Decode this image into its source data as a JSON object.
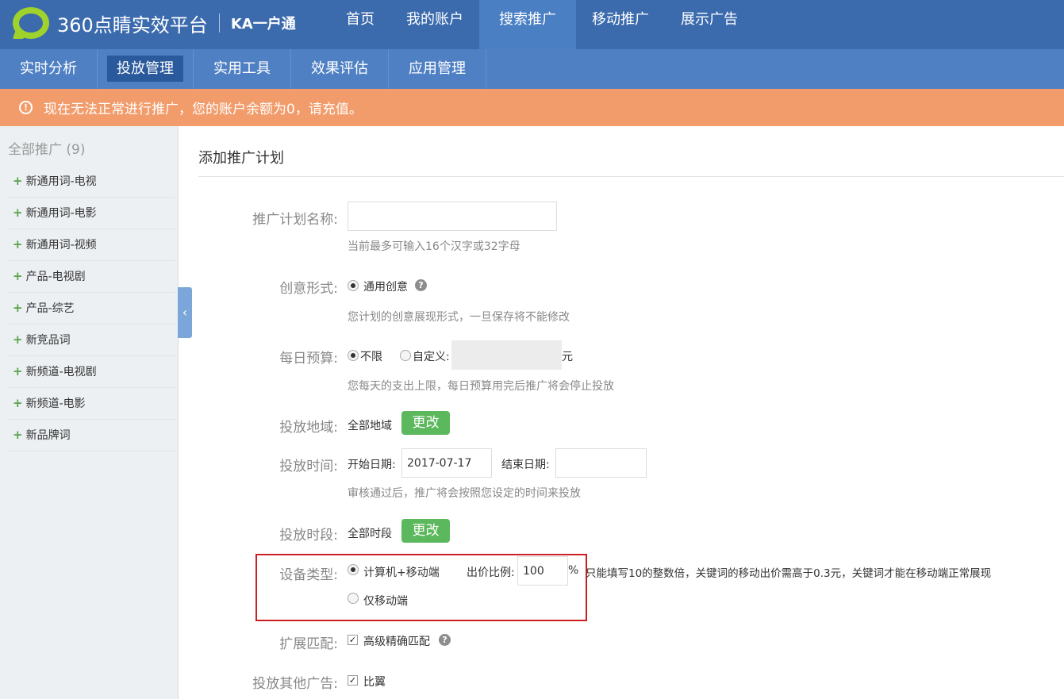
{
  "brand": {
    "name": "360点睛实效平台",
    "product": "KA一户通"
  },
  "topnav": [
    "首页",
    "我的账户",
    "搜索推广",
    "移动推广",
    "展示广告"
  ],
  "subnav": [
    "实时分析",
    "投放管理",
    "实用工具",
    "效果评估",
    "应用管理"
  ],
  "alert": {
    "text": "现在无法正常进行推广，您的账户余额为0，请充值。"
  },
  "sidebar": {
    "title": "全部推广 (9)",
    "items": [
      "新通用词-电视",
      "新通用词-电影",
      "新通用词-视频",
      "产品-电视剧",
      "产品-综艺",
      "新竞品词",
      "新频道-电视剧",
      "新频道-电影",
      "新品牌词"
    ]
  },
  "form": {
    "title": "添加推广计划",
    "plan_name": {
      "label": "推广计划名称:",
      "value": "",
      "hint": "当前最多可输入16个汉字或32字母"
    },
    "creative": {
      "label": "创意形式:",
      "option": "通用创意",
      "hint": "您计划的创意展现形式，一旦保存将不能修改"
    },
    "budget": {
      "label": "每日预算:",
      "opt_unlimited": "不限",
      "opt_custom": "自定义:",
      "unit": "元",
      "hint": "您每天的支出上限，每日预算用完后推广将会停止投放"
    },
    "region": {
      "label": "投放地域:",
      "value": "全部地域",
      "button": "更改"
    },
    "time": {
      "label": "投放时间:",
      "start_label": "开始日期:",
      "start_value": "2017-07-17",
      "end_label": "结束日期:",
      "end_value": "",
      "hint": "审核通过后，推广将会按照您设定的时间来投放"
    },
    "slot": {
      "label": "投放时段:",
      "value": "全部时段",
      "button": "更改"
    },
    "device": {
      "label": "设备类型:",
      "opt_all": "计算机+移动端",
      "ratio_label": "出价比例:",
      "ratio_value": "100",
      "ratio_unit": "%",
      "ratio_hint": "只能填写10的整数倍，关键词的移动出价需高于0.3元，关键词才能在移动端正常展现",
      "opt_mobile": "仅移动端"
    },
    "match": {
      "label": "扩展匹配:",
      "option": "高级精确匹配"
    },
    "other": {
      "label": "投放其他广告:",
      "option": "比翼"
    }
  }
}
